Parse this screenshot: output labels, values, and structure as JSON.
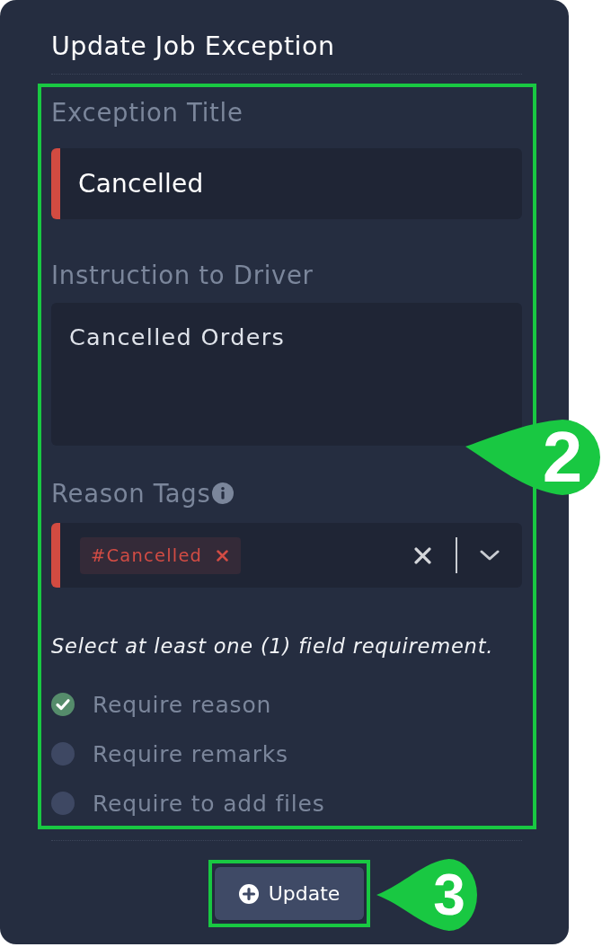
{
  "title": "Update Job Exception",
  "form_callout": "2",
  "fields": [
    {
      "kind": "text",
      "label": "Exception Title",
      "info": false,
      "value": "Cancelled",
      "invalid": true
    },
    {
      "kind": "textarea",
      "label": "Instruction to Driver",
      "info": false,
      "value": "Cancelled Orders",
      "invalid": false
    },
    {
      "kind": "tags",
      "label": "Reason Tags",
      "info": true,
      "tags": [
        "#Cancelled"
      ],
      "invalid": true
    }
  ],
  "hint": "Select at least one (1) field requirement.",
  "requirements": [
    {
      "label": "Require reason",
      "checked": true
    },
    {
      "label": "Require remarks",
      "checked": false
    },
    {
      "label": "Require to add files",
      "checked": false
    }
  ],
  "button": {
    "label": "Update",
    "callout": "3"
  }
}
